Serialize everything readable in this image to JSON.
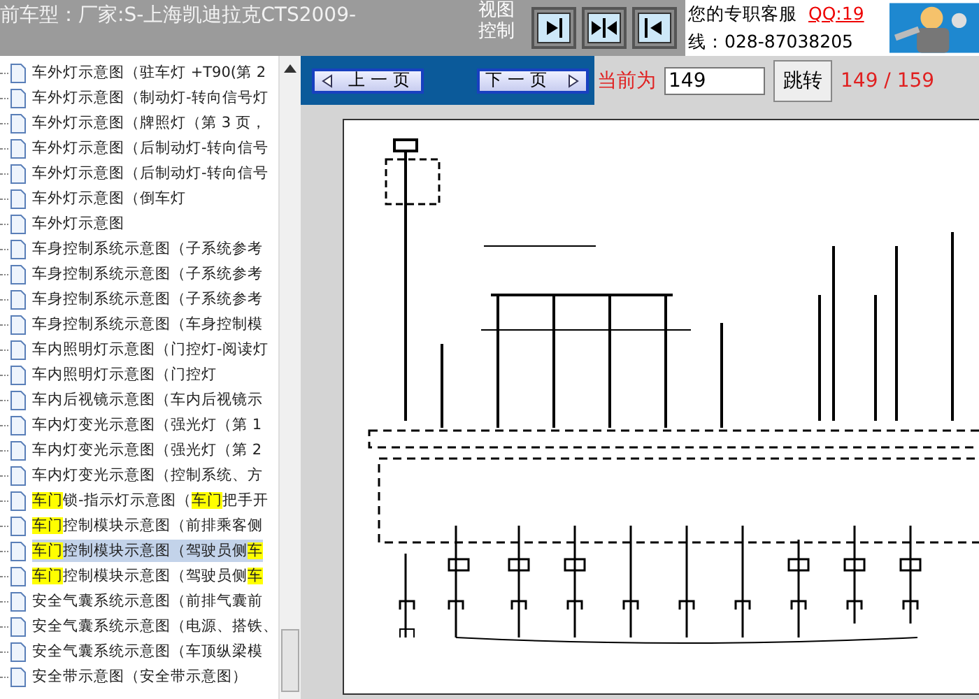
{
  "header": {
    "title": "前车型：厂家:S-上海凯迪拉克CTS2009-",
    "view_control_label": "视图控制",
    "view_buttons": [
      {
        "kind": "right"
      },
      {
        "kind": "both"
      },
      {
        "kind": "left"
      }
    ],
    "support_text": "您的专职客服",
    "qq_link": "QQ:19",
    "phone": "线：028-87038205"
  },
  "tree": {
    "items": [
      {
        "selected": false,
        "parts": [
          {
            "text": "车外灯示意图（驻车灯 +T90(第 2",
            "highlight": false
          }
        ]
      },
      {
        "selected": false,
        "parts": [
          {
            "text": "车外灯示意图（制动灯-转向信号灯",
            "highlight": false
          }
        ]
      },
      {
        "selected": false,
        "parts": [
          {
            "text": "车外灯示意图（牌照灯（第 3 页，",
            "highlight": false
          }
        ]
      },
      {
        "selected": false,
        "parts": [
          {
            "text": "车外灯示意图（后制动灯-转向信号",
            "highlight": false
          }
        ]
      },
      {
        "selected": false,
        "parts": [
          {
            "text": "车外灯示意图（后制动灯-转向信号",
            "highlight": false
          }
        ]
      },
      {
        "selected": false,
        "parts": [
          {
            "text": "车外灯示意图（倒车灯",
            "highlight": false
          }
        ]
      },
      {
        "selected": false,
        "parts": [
          {
            "text": "车外灯示意图",
            "highlight": false
          }
        ]
      },
      {
        "selected": false,
        "parts": [
          {
            "text": "车身控制系统示意图（子系统参考",
            "highlight": false
          }
        ]
      },
      {
        "selected": false,
        "parts": [
          {
            "text": "车身控制系统示意图（子系统参考",
            "highlight": false
          }
        ]
      },
      {
        "selected": false,
        "parts": [
          {
            "text": "车身控制系统示意图（子系统参考",
            "highlight": false
          }
        ]
      },
      {
        "selected": false,
        "parts": [
          {
            "text": "车身控制系统示意图（车身控制模",
            "highlight": false
          }
        ]
      },
      {
        "selected": false,
        "parts": [
          {
            "text": "车内照明灯示意图（门控灯-阅读灯",
            "highlight": false
          }
        ]
      },
      {
        "selected": false,
        "parts": [
          {
            "text": "车内照明灯示意图（门控灯",
            "highlight": false
          }
        ]
      },
      {
        "selected": false,
        "parts": [
          {
            "text": "车内后视镜示意图（车内后视镜示",
            "highlight": false
          }
        ]
      },
      {
        "selected": false,
        "parts": [
          {
            "text": "车内灯变光示意图（强光灯（第 1",
            "highlight": false
          }
        ]
      },
      {
        "selected": false,
        "parts": [
          {
            "text": "车内灯变光示意图（强光灯（第 2",
            "highlight": false
          }
        ]
      },
      {
        "selected": false,
        "parts": [
          {
            "text": "车内灯变光示意图（控制系统、方",
            "highlight": false
          }
        ]
      },
      {
        "selected": false,
        "parts": [
          {
            "text": "车门",
            "highlight": true
          },
          {
            "text": "锁-指示灯示意图（",
            "highlight": false
          },
          {
            "text": "车门",
            "highlight": true
          },
          {
            "text": "把手开",
            "highlight": false
          }
        ]
      },
      {
        "selected": false,
        "parts": [
          {
            "text": "车门",
            "highlight": true
          },
          {
            "text": "控制模块示意图（前排乘客侧",
            "highlight": false
          }
        ]
      },
      {
        "selected": true,
        "parts": [
          {
            "text": "车门",
            "highlight": true
          },
          {
            "text": "控制模块示意图（驾驶员侧",
            "highlight": false
          },
          {
            "text": "车",
            "highlight": true
          }
        ]
      },
      {
        "selected": false,
        "parts": [
          {
            "text": "车门",
            "highlight": true
          },
          {
            "text": "控制模块示意图（驾驶员侧",
            "highlight": false
          },
          {
            "text": "车",
            "highlight": true
          }
        ]
      },
      {
        "selected": false,
        "parts": [
          {
            "text": "安全气囊系统示意图（前排气囊前",
            "highlight": false
          }
        ]
      },
      {
        "selected": false,
        "parts": [
          {
            "text": "安全气囊系统示意图（电源、搭铁、",
            "highlight": false
          }
        ]
      },
      {
        "selected": false,
        "parts": [
          {
            "text": "安全气囊系统示意图（车顶纵梁模",
            "highlight": false
          }
        ]
      },
      {
        "selected": false,
        "parts": [
          {
            "text": "安全带示意图（安全带示意图）",
            "highlight": false
          }
        ]
      }
    ]
  },
  "pager": {
    "prev": "上一页",
    "next": "下一页",
    "current_label": "当前为",
    "page_value": "149",
    "go": "跳转",
    "page_count": "149 / 159"
  }
}
